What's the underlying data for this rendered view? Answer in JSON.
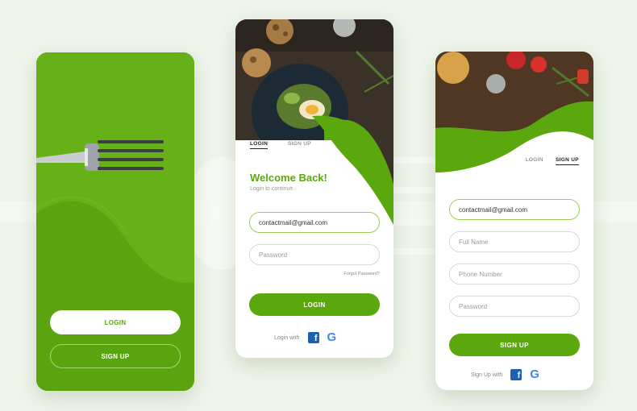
{
  "colors": {
    "brand_green": "#5aa80e",
    "panel_green": "#63ad14",
    "background": "#eef4ea",
    "facebook_blue": "#1f5fb3"
  },
  "icons": [
    "fork-icon",
    "facebook-icon",
    "google-icon"
  ],
  "welcome_screen": {
    "login_button": "LOGIN",
    "signup_button": "SIGN UP"
  },
  "login_screen": {
    "tabs": [
      {
        "label": "LOGIN",
        "selected": true
      },
      {
        "label": "SIGN UP",
        "selected": false
      }
    ],
    "title": "Welcome Back!",
    "subtitle": "Login to continue",
    "email_value": "contactmail@gmail.com",
    "password_placeholder": "Password",
    "forgot_password": "Forgot Password?",
    "login_button": "LOGIN",
    "social_label": "Login with",
    "google_glyph": "G"
  },
  "signup_screen": {
    "tabs": [
      {
        "label": "LOGIN",
        "selected": false
      },
      {
        "label": "SIGN UP",
        "selected": true
      }
    ],
    "email_value": "contactmail@gmail.com",
    "full_name_placeholder": "Full Name",
    "phone_placeholder": "Phone Number",
    "password_placeholder": "Password",
    "signup_button": "SIGN UP",
    "social_label": "Sign Up with",
    "google_glyph": "G"
  }
}
